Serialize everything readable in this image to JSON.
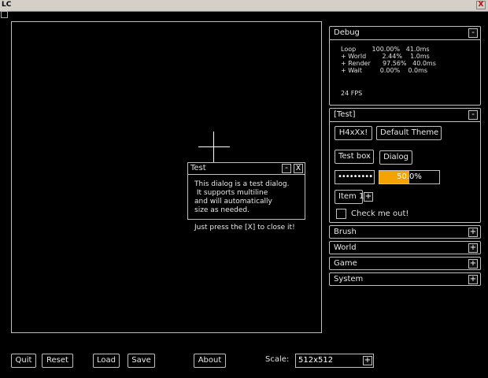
{
  "window": {
    "title": "LC",
    "close_glyph": "X"
  },
  "debug": {
    "title": "Debug",
    "lines": [
      "Loop        100.00%   41.0ms",
      "+ World        2.44%    1.0ms",
      "+ Render      97.56%   40.0ms",
      "+ Wait         0.00%    0.0ms"
    ],
    "fps": "24 FPS",
    "collapse_glyph": "-"
  },
  "test_panel": {
    "title": "[Test]",
    "collapse_glyph": "-",
    "h4x_button": "H4xXx!",
    "theme_button": "Default Theme",
    "testbox_button": "Test box",
    "dialog_button": "Dialog",
    "password_value": "•••••••••",
    "progress": {
      "percent": 50.0,
      "label": "50.0%",
      "color": "#f5a300"
    },
    "item_label": "Item 1",
    "item_plus": "+",
    "checkbox_label": "Check me out!"
  },
  "collapsed_panels": [
    {
      "title": "Brush",
      "glyph": "+"
    },
    {
      "title": "World",
      "glyph": "+"
    },
    {
      "title": "Game",
      "glyph": "+"
    },
    {
      "title": "System",
      "glyph": "+"
    }
  ],
  "dialog": {
    "title": "Test",
    "minimize_glyph": "-",
    "close_glyph": "X",
    "text": "This dialog is a test dialog.\n It supports multiline\nand will automatically\nsize as needed.\n\nJust press the [X] to close it!"
  },
  "bottom_bar": {
    "quit": "Quit",
    "reset": "Reset",
    "load": "Load",
    "save": "Save",
    "about": "About",
    "scale_label": "Scale:",
    "scale_value": "512x512",
    "scale_plus": "+"
  }
}
